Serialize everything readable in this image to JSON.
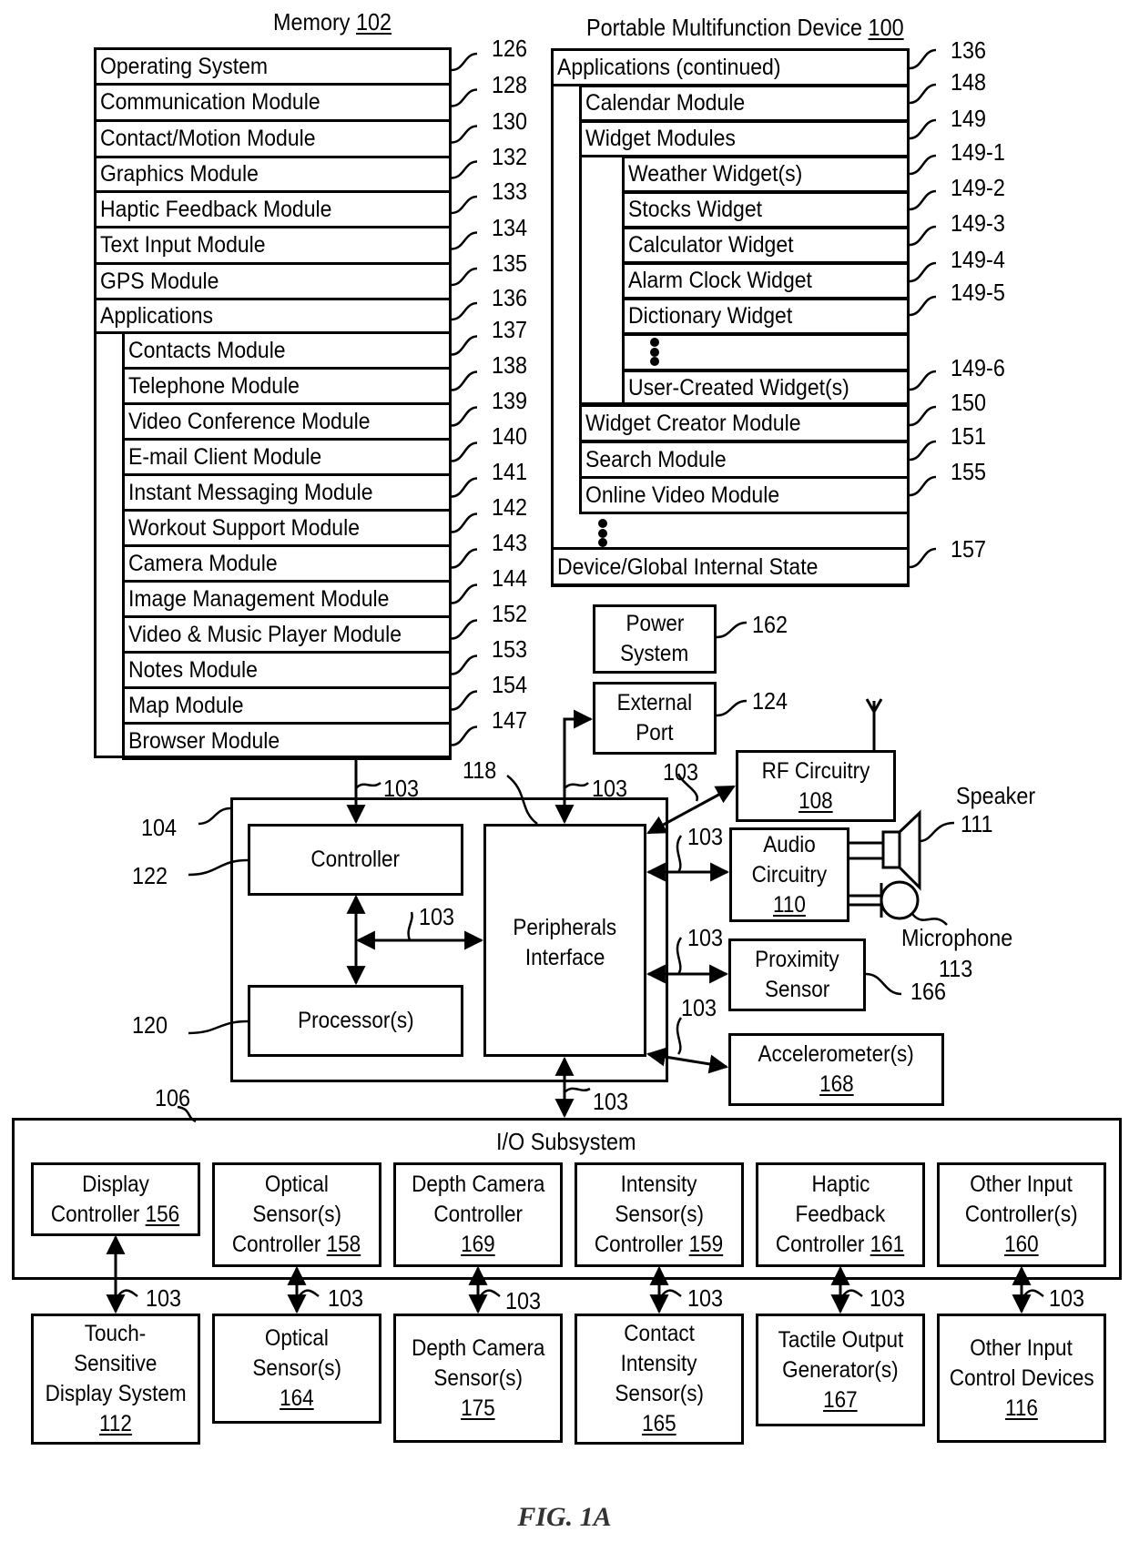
{
  "memory": {
    "title": "Memory",
    "ref": "102",
    "rows": [
      {
        "label": "Operating System",
        "ref": "126"
      },
      {
        "label": "Communication Module",
        "ref": "128"
      },
      {
        "label": "Contact/Motion Module",
        "ref": "130"
      },
      {
        "label": "Graphics Module",
        "ref": "132"
      },
      {
        "label": "Haptic Feedback Module",
        "ref": "133"
      },
      {
        "label": "Text Input Module",
        "ref": "134"
      },
      {
        "label": "GPS Module",
        "ref": "135"
      },
      {
        "label": "Applications",
        "ref": "136"
      }
    ],
    "apps": [
      {
        "label": "Contacts Module",
        "ref": "137"
      },
      {
        "label": "Telephone Module",
        "ref": "138"
      },
      {
        "label": "Video Conference Module",
        "ref": "139"
      },
      {
        "label": "E-mail Client Module",
        "ref": "140"
      },
      {
        "label": "Instant Messaging Module",
        "ref": "141"
      },
      {
        "label": "Workout Support Module",
        "ref": "142"
      },
      {
        "label": "Camera Module",
        "ref": "143"
      },
      {
        "label": "Image Management Module",
        "ref": "144"
      },
      {
        "label": "Video & Music Player Module",
        "ref": "152"
      },
      {
        "label": "Notes Module",
        "ref": "153"
      },
      {
        "label": "Map Module",
        "ref": "154"
      },
      {
        "label": "Browser Module",
        "ref": "147"
      }
    ]
  },
  "device": {
    "title": "Portable Multifunction Device",
    "ref": "100",
    "apps_continued": {
      "label": "Applications (continued)",
      "ref": "136"
    },
    "calendar": {
      "label": "Calendar Module",
      "ref": "148"
    },
    "widget_modules": {
      "label": "Widget Modules",
      "ref": "149"
    },
    "widgets": [
      {
        "label": "Weather Widget(s)",
        "ref": "149-1"
      },
      {
        "label": "Stocks Widget",
        "ref": "149-2"
      },
      {
        "label": "Calculator Widget",
        "ref": "149-3"
      },
      {
        "label": "Alarm Clock Widget",
        "ref": "149-4"
      },
      {
        "label": "Dictionary Widget",
        "ref": "149-5"
      },
      {
        "label": "User-Created Widget(s)",
        "ref": "149-6"
      }
    ],
    "after_widgets": [
      {
        "label": "Widget Creator Module",
        "ref": "150"
      },
      {
        "label": "Search Module",
        "ref": "151"
      },
      {
        "label": "Online Video Module",
        "ref": "155"
      }
    ],
    "state": {
      "label": "Device/Global Internal State",
      "ref": "157"
    }
  },
  "power": {
    "line1": "Power",
    "line2": "System",
    "ref": "162"
  },
  "external_port": {
    "line1": "External",
    "line2": "Port",
    "ref": "124"
  },
  "rf": {
    "line1": "RF Circuitry",
    "num": "108"
  },
  "audio": {
    "line1": "Audio",
    "line2": "Circuitry",
    "num": "110"
  },
  "speaker": {
    "label": "Speaker",
    "ref": "111"
  },
  "microphone": {
    "label": "Microphone",
    "ref": "113"
  },
  "proximity": {
    "line1": "Proximity",
    "line2": "Sensor",
    "ref": "166"
  },
  "accelerometer": {
    "line1": "Accelerometer(s)",
    "num": "168"
  },
  "chip": {
    "ref": "104",
    "controller": {
      "label": "Controller",
      "ref": "122"
    },
    "processor": {
      "label": "Processor(s)",
      "ref": "120"
    },
    "peripherals": {
      "line1": "Peripherals",
      "line2": "Interface",
      "ref": "118"
    }
  },
  "bus_ref": "103",
  "io": {
    "title": "I/O Subsystem",
    "ref": "106",
    "controllers": [
      {
        "lines": [
          "Display",
          "Controller"
        ],
        "num": "156",
        "inline": true
      },
      {
        "lines": [
          "Optical",
          "Sensor(s)",
          "Controller"
        ],
        "num": "158",
        "inline": true
      },
      {
        "lines": [
          "Depth Camera",
          "Controller"
        ],
        "num": "169",
        "inline": false
      },
      {
        "lines": [
          "Intensity",
          "Sensor(s)",
          "Controller"
        ],
        "num": "159",
        "inline": true
      },
      {
        "lines": [
          "Haptic",
          "Feedback",
          "Controller"
        ],
        "num": "161",
        "inline": true
      },
      {
        "lines": [
          "Other Input",
          "Controller(s)"
        ],
        "num": "160",
        "inline": false
      }
    ],
    "devices": [
      {
        "lines": [
          "Touch-",
          "Sensitive",
          "Display System"
        ],
        "num": "112"
      },
      {
        "lines": [
          "Optical",
          "Sensor(s)"
        ],
        "num": "164"
      },
      {
        "lines": [
          "Depth Camera",
          "Sensor(s)"
        ],
        "num": "175"
      },
      {
        "lines": [
          "Contact",
          "Intensity",
          "Sensor(s)"
        ],
        "num": "165"
      },
      {
        "lines": [
          "Tactile Output",
          "Generator(s)"
        ],
        "num": "167"
      },
      {
        "lines": [
          "Other Input",
          "Control Devices"
        ],
        "num": "116"
      }
    ]
  },
  "figure_caption": "FIG. 1A"
}
